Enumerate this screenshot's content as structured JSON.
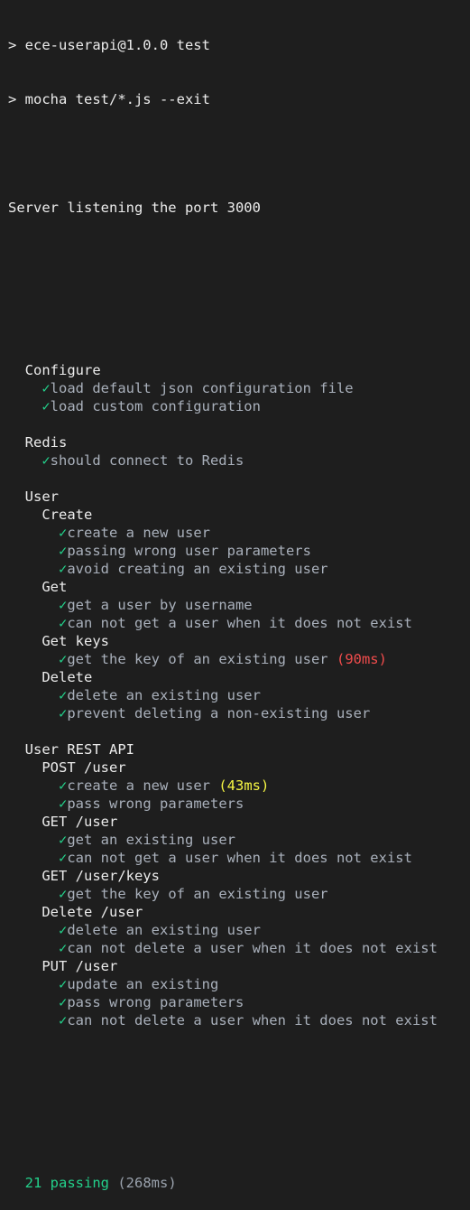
{
  "terminal": {
    "commands": [
      "> ece-userapi@1.0.0 test",
      "> mocha test/*.js --exit"
    ],
    "server_message": "Server listening the port 3000",
    "check_glyph": "✓",
    "suites": [
      {
        "title": "Configure",
        "tests": [
          {
            "title": "load default json configuration file"
          },
          {
            "title": "load custom configuration"
          }
        ]
      },
      {
        "title": "Redis",
        "tests": [
          {
            "title": "should connect to Redis"
          }
        ]
      },
      {
        "title": "User",
        "subsuites": [
          {
            "title": "Create",
            "tests": [
              {
                "title": "create a new user"
              },
              {
                "title": "passing wrong user parameters"
              },
              {
                "title": "avoid creating an existing user"
              }
            ]
          },
          {
            "title": "Get",
            "tests": [
              {
                "title": "get a user by username"
              },
              {
                "title": "can not get a user when it does not exist"
              }
            ]
          },
          {
            "title": "Get keys",
            "tests": [
              {
                "title": "get the key of an existing user",
                "duration": "(90ms)",
                "duration_color": "red"
              }
            ]
          },
          {
            "title": "Delete",
            "tests": [
              {
                "title": "delete an existing user"
              },
              {
                "title": "prevent deleting a non-existing user"
              }
            ]
          }
        ]
      },
      {
        "title": "User REST API",
        "subsuites": [
          {
            "title": "POST /user",
            "tests": [
              {
                "title": "create a new user",
                "duration": "(43ms)",
                "duration_color": "yellow"
              },
              {
                "title": "pass wrong parameters"
              }
            ]
          },
          {
            "title": "GET /user",
            "tests": [
              {
                "title": "get an existing user"
              },
              {
                "title": "can not get a user when it does not exist"
              }
            ]
          },
          {
            "title": "GET /user/keys",
            "tests": [
              {
                "title": "get the key of an existing user"
              }
            ]
          },
          {
            "title": "Delete /user",
            "tests": [
              {
                "title": "delete an existing user"
              },
              {
                "title": "can not delete a user when it does not exist"
              }
            ]
          },
          {
            "title": "PUT /user",
            "tests": [
              {
                "title": "update an existing"
              },
              {
                "title": "pass wrong parameters"
              },
              {
                "title": "can not delete a user when it does not exist"
              }
            ]
          }
        ]
      }
    ],
    "summary": {
      "passing": "21 passing",
      "duration": "(268ms)"
    },
    "colors": {
      "background": "#1e1e1e",
      "check": "#23d18b",
      "passing": "#23d18b",
      "slow_red": "#f14c4c",
      "medium_yellow": "#f5f543",
      "test_text": "#a9b0bb",
      "heading_text": "#ececec"
    }
  }
}
